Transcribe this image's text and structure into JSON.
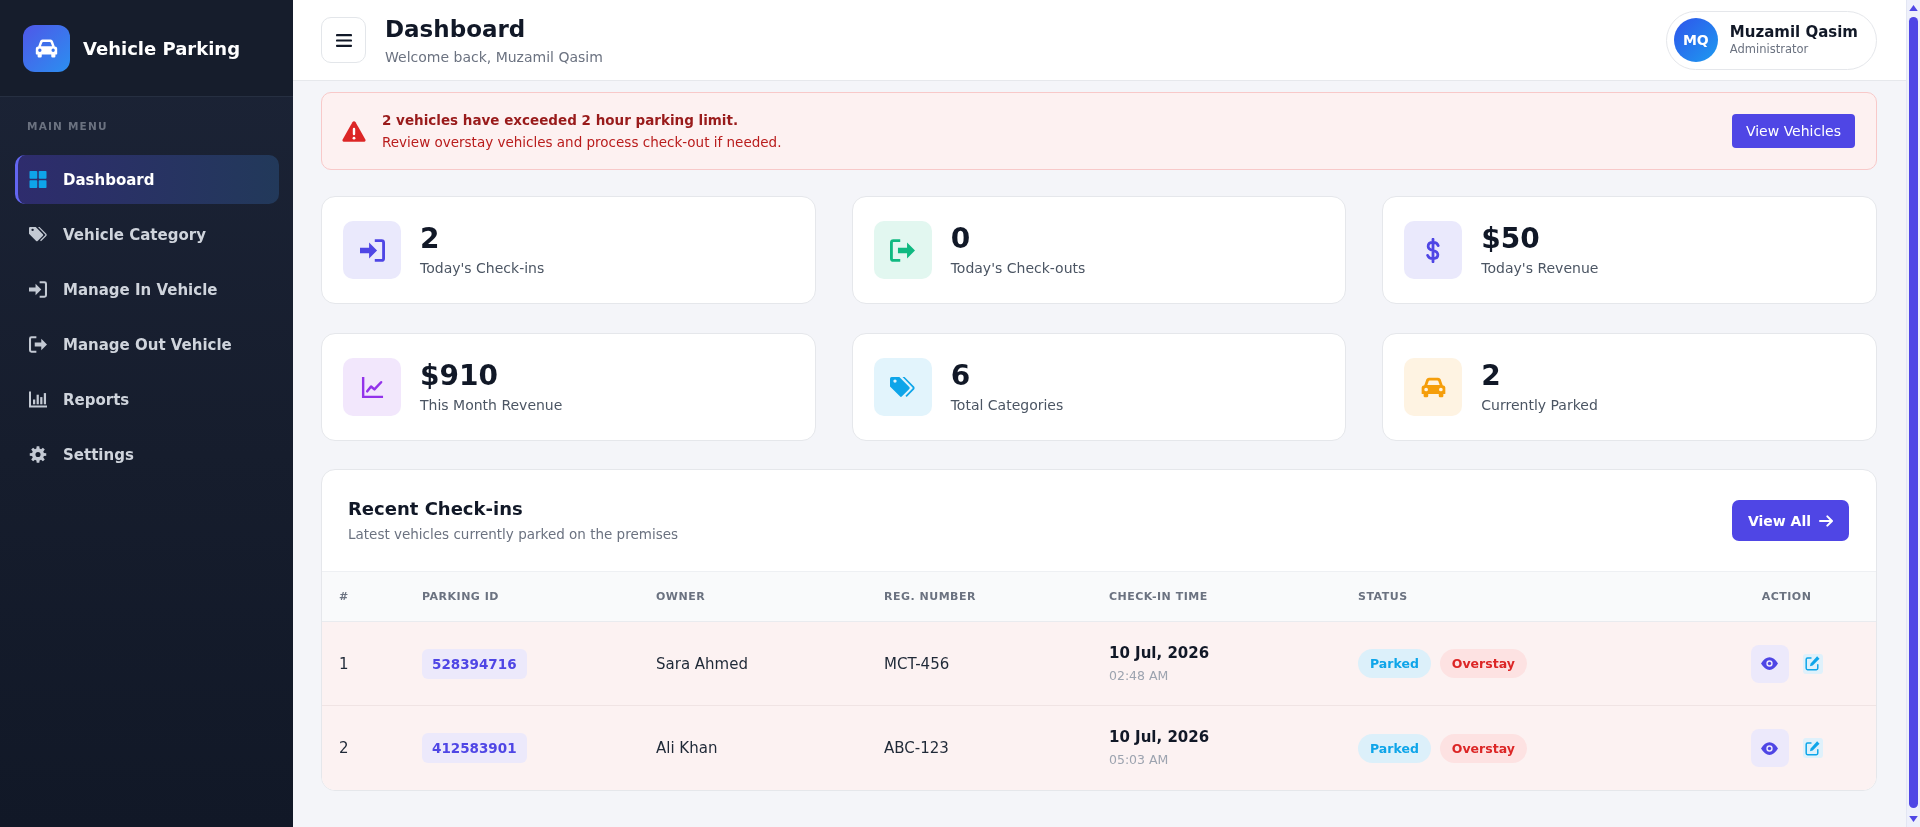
{
  "sidebar": {
    "brand": "Vehicle Parking",
    "section": "MAIN MENU",
    "items": [
      {
        "label": "Dashboard",
        "selected": true
      },
      {
        "label": "Vehicle Category",
        "selected": false
      },
      {
        "label": "Manage In Vehicle",
        "selected": false
      },
      {
        "label": "Manage Out Vehicle",
        "selected": false
      },
      {
        "label": "Reports",
        "selected": false
      },
      {
        "label": "Settings",
        "selected": false
      }
    ]
  },
  "header": {
    "title": "Dashboard",
    "subtitle": "Welcome back, Muzamil Qasim",
    "user": {
      "initials": "MQ",
      "name": "Muzamil Qasim",
      "role": "Administrator"
    }
  },
  "alert": {
    "title": "2 vehicles have exceeded 2 hour parking limit.",
    "message": "Review overstay vehicles and process check-out if needed.",
    "button": "View Vehicles"
  },
  "stats": [
    {
      "value": "2",
      "label": "Today's Check-ins",
      "color": "#4f46e5"
    },
    {
      "value": "0",
      "label": "Today's Check-outs",
      "color": "#10b981"
    },
    {
      "value": "$50",
      "label": "Today's Revenue",
      "color": "#4f46e5"
    },
    {
      "value": "$910",
      "label": "This Month Revenue",
      "color": "#9333ea"
    },
    {
      "value": "6",
      "label": "Total Categories",
      "color": "#0ea5e9"
    },
    {
      "value": "2",
      "label": "Currently Parked",
      "color": "#f59e0b"
    }
  ],
  "recent_checkins": {
    "title": "Recent Check-ins",
    "subtitle": "Latest vehicles currently parked on the premises",
    "button": "View All",
    "columns": [
      "#",
      "PARKING ID",
      "OWNER",
      "REG. NUMBER",
      "CHECK-IN TIME",
      "STATUS",
      "ACTION"
    ],
    "rows": [
      {
        "index": "1",
        "parking_id": "528394716",
        "owner": "Sara Ahmed",
        "reg_number": "MCT-456",
        "date": "10 Jul, 2026",
        "time": "02:48 AM",
        "statuses": [
          {
            "label": "Parked",
            "kind": "parked"
          },
          {
            "label": "Overstay",
            "kind": "overstay"
          }
        ]
      },
      {
        "index": "2",
        "parking_id": "412583901",
        "owner": "Ali Khan",
        "reg_number": "ABC-123",
        "date": "10 Jul, 2026",
        "time": "05:03 AM",
        "statuses": [
          {
            "label": "Parked",
            "kind": "parked"
          },
          {
            "label": "Overstay",
            "kind": "overstay"
          }
        ]
      }
    ]
  }
}
